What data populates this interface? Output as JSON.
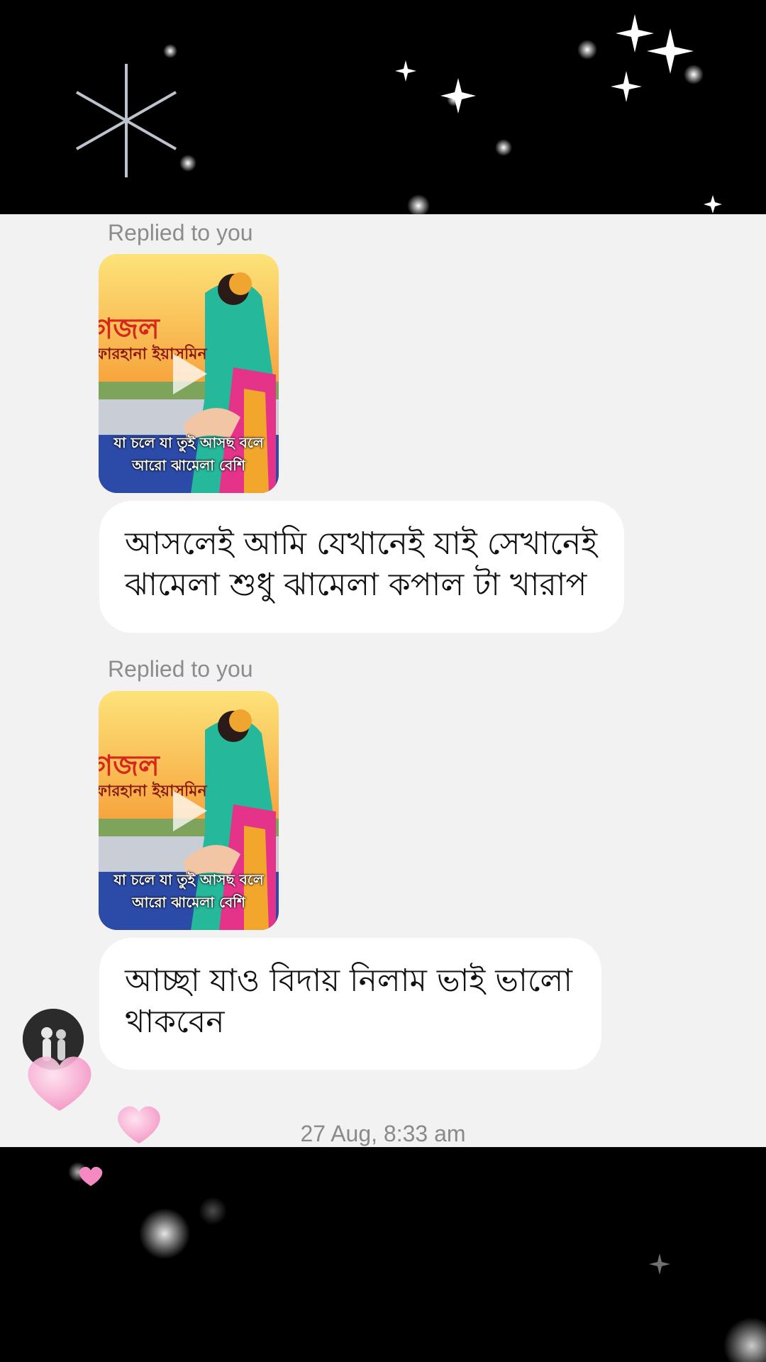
{
  "conversation": {
    "messages": [
      {
        "reply_label": "Replied to you",
        "media": {
          "icon": "play-icon",
          "poster_title": "গজল",
          "poster_sub": "ফারহানা ইয়াসমিন",
          "poster_line1": "যা চলে যা তুই আসছ বলে",
          "poster_line2": "আরো ঝামেলা বেশি"
        },
        "text": "আসলেই আমি যেখানেই যাই সেখানেই ঝামেলা শুধু ঝামেলা কপাল টা খারাপ"
      },
      {
        "reply_label": "Replied to you",
        "media": {
          "icon": "play-icon",
          "poster_title": "গজল",
          "poster_sub": "ফারহানা ইয়াসমিন",
          "poster_line1": "যা চলে যা তুই আসছ বলে",
          "poster_line2": "আরো ঝামেলা বেশি"
        },
        "text": "আচ্ছা যাও বিদায় নিলাম ভাই ভালো থাকবেন"
      }
    ],
    "timestamp": "27 Aug, 8:33 am"
  },
  "colors": {
    "chat_background": "#f2f2f2",
    "bubble": "#ffffff",
    "frame": "#000000"
  }
}
